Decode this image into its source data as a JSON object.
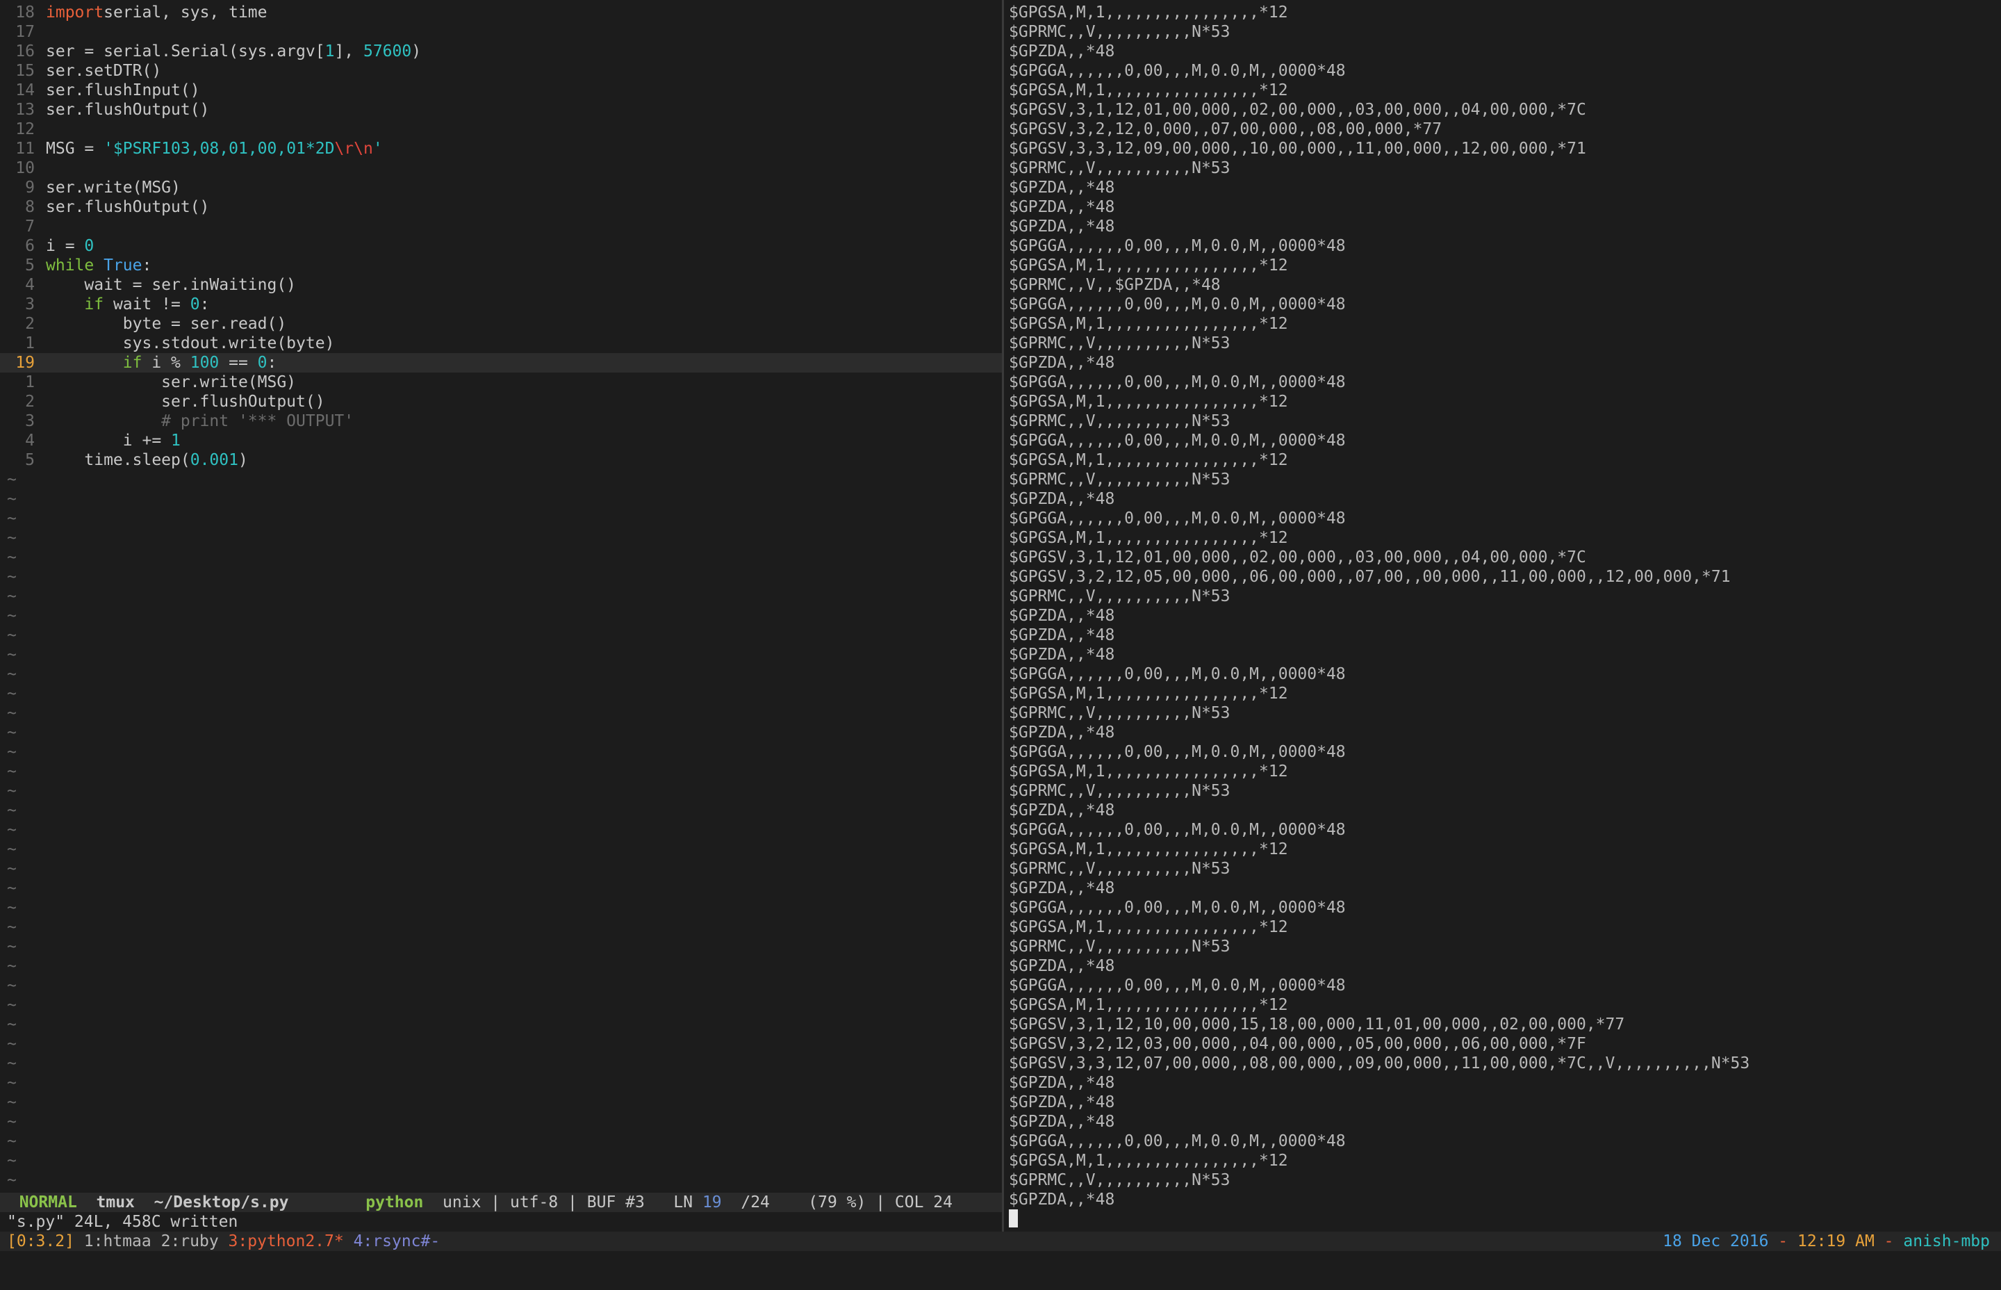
{
  "editor": {
    "code_lines": [
      {
        "ln": "18",
        "segs": [
          [
            "kw",
            "import"
          ],
          [
            "",
            "serial, sys, time"
          ]
        ]
      },
      {
        "ln": "17",
        "segs": []
      },
      {
        "ln": "16",
        "segs": [
          [
            "",
            "ser = serial.Serial(sys.argv["
          ],
          [
            "num",
            "1"
          ],
          [
            "",
            "], "
          ],
          [
            "num",
            "57600"
          ],
          [
            "",
            ")"
          ]
        ]
      },
      {
        "ln": "15",
        "segs": [
          [
            "",
            "ser.setDTR()"
          ]
        ]
      },
      {
        "ln": "14",
        "segs": [
          [
            "",
            "ser.flushInput()"
          ]
        ]
      },
      {
        "ln": "13",
        "segs": [
          [
            "",
            "ser.flushOutput()"
          ]
        ]
      },
      {
        "ln": "12",
        "segs": []
      },
      {
        "ln": "11",
        "segs": [
          [
            "",
            "MSG = "
          ],
          [
            "str",
            "'$PSRF103,08,01,00,01*2D"
          ],
          [
            "esc",
            "\\r\\n"
          ],
          [
            "str",
            "'"
          ]
        ]
      },
      {
        "ln": "10",
        "segs": []
      },
      {
        "ln": "9",
        "segs": [
          [
            "",
            "ser.write(MSG)"
          ]
        ]
      },
      {
        "ln": "8",
        "segs": [
          [
            "",
            "ser.flushOutput()"
          ]
        ]
      },
      {
        "ln": "7",
        "segs": []
      },
      {
        "ln": "6",
        "segs": [
          [
            "",
            "i = "
          ],
          [
            "num",
            "0"
          ]
        ]
      },
      {
        "ln": "5",
        "segs": [
          [
            "kw2",
            "while"
          ],
          [
            "",
            " "
          ],
          [
            "bi",
            "True"
          ],
          [
            "",
            ":"
          ]
        ]
      },
      {
        "ln": "4",
        "segs": [
          [
            "",
            "    wait = ser.inWaiting()"
          ]
        ]
      },
      {
        "ln": "3",
        "segs": [
          [
            "",
            "    "
          ],
          [
            "kw2",
            "if"
          ],
          [
            "",
            " wait != "
          ],
          [
            "num",
            "0"
          ],
          [
            "",
            ":"
          ]
        ]
      },
      {
        "ln": "2",
        "segs": [
          [
            "",
            "        byte = ser.read()"
          ]
        ]
      },
      {
        "ln": "1",
        "segs": [
          [
            "",
            "        sys.stdout.write(byte)"
          ]
        ]
      },
      {
        "ln": "19",
        "current": true,
        "segs": [
          [
            "",
            "        "
          ],
          [
            "kw2",
            "if"
          ],
          [
            "",
            " i % "
          ],
          [
            "num",
            "100"
          ],
          [
            "",
            " == "
          ],
          [
            "num",
            "0"
          ],
          [
            "",
            ":"
          ]
        ]
      },
      {
        "ln": "1",
        "segs": [
          [
            "",
            "            ser.write(MSG)"
          ]
        ]
      },
      {
        "ln": "2",
        "segs": [
          [
            "",
            "            ser.flushOutput()"
          ]
        ]
      },
      {
        "ln": "3",
        "segs": [
          [
            "",
            "            "
          ],
          [
            "cmt",
            "# print '*** OUTPUT'"
          ]
        ]
      },
      {
        "ln": "4",
        "segs": [
          [
            "",
            "        i += "
          ],
          [
            "num",
            "1"
          ]
        ]
      },
      {
        "ln": "5",
        "segs": [
          [
            "",
            "    time.sleep("
          ],
          [
            "num",
            "0.001"
          ],
          [
            "",
            ")"
          ]
        ]
      }
    ],
    "tilde_char": "~",
    "status": {
      "mode": "NORMAL",
      "session": "tmux",
      "path": "~/Desktop/s.py",
      "filetype": "python",
      "format": "unix | utf-8 | BUF #3",
      "ln_label": "LN",
      "ln_value": "19",
      "total": "/24",
      "percent": "(79 %) | COL 24"
    },
    "cmdline": "\"s.py\" 24L, 458C written"
  },
  "terminal": {
    "lines": [
      "$GPGSA,M,1,,,,,,,,,,,,,,,,*12",
      "$GPRMC,,V,,,,,,,,,,N*53",
      "$GPZDA,,*48",
      "$GPGGA,,,,,,0,00,,,M,0.0,M,,0000*48",
      "$GPGSA,M,1,,,,,,,,,,,,,,,,*12",
      "$GPGSV,3,1,12,01,00,000,,02,00,000,,03,00,000,,04,00,000,*7C",
      "$GPGSV,3,2,12,0,000,,07,00,000,,08,00,000,*77",
      "$GPGSV,3,3,12,09,00,000,,10,00,000,,11,00,000,,12,00,000,*71",
      "$GPRMC,,V,,,,,,,,,,N*53",
      "$GPZDA,,*48",
      "$GPZDA,,*48",
      "$GPZDA,,*48",
      "$GPGGA,,,,,,0,00,,,M,0.0,M,,0000*48",
      "$GPGSA,M,1,,,,,,,,,,,,,,,,*12",
      "$GPRMC,,V,,$GPZDA,,*48",
      "$GPGGA,,,,,,0,00,,,M,0.0,M,,0000*48",
      "$GPGSA,M,1,,,,,,,,,,,,,,,,*12",
      "$GPRMC,,V,,,,,,,,,,N*53",
      "$GPZDA,,*48",
      "$GPGGA,,,,,,0,00,,,M,0.0,M,,0000*48",
      "$GPGSA,M,1,,,,,,,,,,,,,,,,*12",
      "$GPRMC,,V,,,,,,,,,,N*53",
      "$GPGGA,,,,,,0,00,,,M,0.0,M,,0000*48",
      "$GPGSA,M,1,,,,,,,,,,,,,,,,*12",
      "$GPRMC,,V,,,,,,,,,,N*53",
      "$GPZDA,,*48",
      "$GPGGA,,,,,,0,00,,,M,0.0,M,,0000*48",
      "$GPGSA,M,1,,,,,,,,,,,,,,,,*12",
      "$GPGSV,3,1,12,01,00,000,,02,00,000,,03,00,000,,04,00,000,*7C",
      "$GPGSV,3,2,12,05,00,000,,06,00,000,,07,00,,00,000,,11,00,000,,12,00,000,*71",
      "$GPRMC,,V,,,,,,,,,,N*53",
      "$GPZDA,,*48",
      "$GPZDA,,*48",
      "$GPZDA,,*48",
      "$GPGGA,,,,,,0,00,,,M,0.0,M,,0000*48",
      "$GPGSA,M,1,,,,,,,,,,,,,,,,*12",
      "$GPRMC,,V,,,,,,,,,,N*53",
      "$GPZDA,,*48",
      "$GPGGA,,,,,,0,00,,,M,0.0,M,,0000*48",
      "$GPGSA,M,1,,,,,,,,,,,,,,,,*12",
      "$GPRMC,,V,,,,,,,,,,N*53",
      "$GPZDA,,*48",
      "$GPGGA,,,,,,0,00,,,M,0.0,M,,0000*48",
      "$GPGSA,M,1,,,,,,,,,,,,,,,,*12",
      "$GPRMC,,V,,,,,,,,,,N*53",
      "$GPZDA,,*48",
      "$GPGGA,,,,,,0,00,,,M,0.0,M,,0000*48",
      "$GPGSA,M,1,,,,,,,,,,,,,,,,*12",
      "$GPRMC,,V,,,,,,,,,,N*53",
      "$GPZDA,,*48",
      "$GPGGA,,,,,,0,00,,,M,0.0,M,,0000*48",
      "$GPGSA,M,1,,,,,,,,,,,,,,,,*12",
      "$GPGSV,3,1,12,10,00,000,15,18,00,000,11,01,00,000,,02,00,000,*77",
      "$GPGSV,3,2,12,03,00,000,,04,00,000,,05,00,000,,06,00,000,*7F",
      "$GPGSV,3,3,12,07,00,000,,08,00,000,,09,00,000,,11,00,000,*7C,,V,,,,,,,,,,N*53",
      "$GPZDA,,*48",
      "$GPZDA,,*48",
      "$GPZDA,,*48",
      "$GPGGA,,,,,,0,00,,,M,0.0,M,,0000*48",
      "$GPGSA,M,1,,,,,,,,,,,,,,,,*12",
      "$GPRMC,,V,,,,,,,,,,N*53",
      "$GPZDA,,*48"
    ]
  },
  "tmux": {
    "session": "[0:3.2]",
    "windows": [
      {
        "label": "1:htmaa",
        "state": "normal"
      },
      {
        "label": "2:ruby",
        "state": "normal"
      },
      {
        "label": "3:python2.7*",
        "state": "active"
      },
      {
        "label": "4:rsync#-",
        "state": "last"
      }
    ],
    "date": "18 Dec 2016",
    "sep": "-",
    "time": "12:19 AM",
    "host": "anish-mbp"
  }
}
